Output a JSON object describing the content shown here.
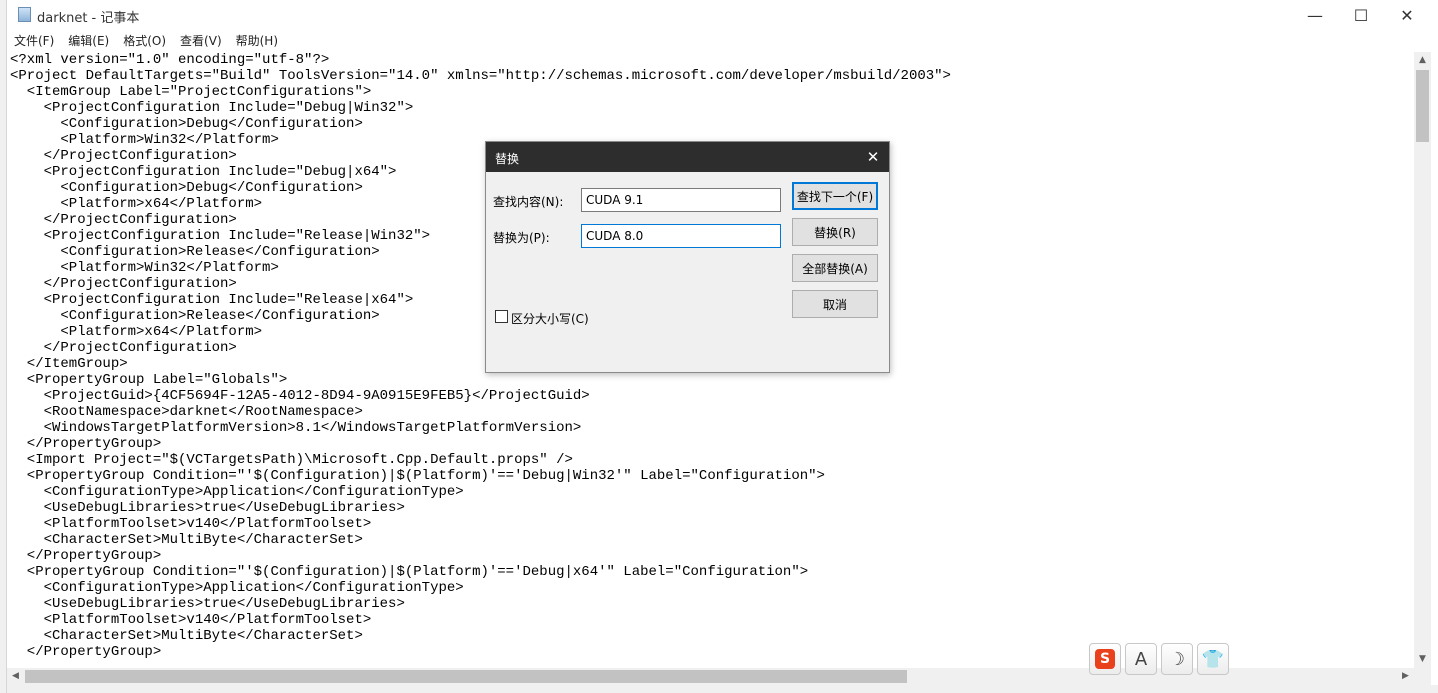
{
  "window": {
    "title": "darknet - 记事本",
    "minimize_glyph": "—",
    "maximize_glyph": "☐",
    "close_glyph": "✕"
  },
  "menu": [
    {
      "label": "文件(F)"
    },
    {
      "label": "编辑(E)"
    },
    {
      "label": "格式(O)"
    },
    {
      "label": "查看(V)"
    },
    {
      "label": "帮助(H)"
    }
  ],
  "editor": {
    "lines": [
      "<?xml version=\"1.0\" encoding=\"utf-8\"?>",
      "<Project DefaultTargets=\"Build\" ToolsVersion=\"14.0\" xmlns=\"http://schemas.microsoft.com/developer/msbuild/2003\">",
      "  <ItemGroup Label=\"ProjectConfigurations\">",
      "    <ProjectConfiguration Include=\"Debug|Win32\">",
      "      <Configuration>Debug</Configuration>",
      "      <Platform>Win32</Platform>",
      "    </ProjectConfiguration>",
      "    <ProjectConfiguration Include=\"Debug|x64\">",
      "      <Configuration>Debug</Configuration>",
      "      <Platform>x64</Platform>",
      "    </ProjectConfiguration>",
      "    <ProjectConfiguration Include=\"Release|Win32\">",
      "      <Configuration>Release</Configuration>",
      "      <Platform>Win32</Platform>",
      "    </ProjectConfiguration>",
      "    <ProjectConfiguration Include=\"Release|x64\">",
      "      <Configuration>Release</Configuration>",
      "      <Platform>x64</Platform>",
      "    </ProjectConfiguration>",
      "  </ItemGroup>",
      "  <PropertyGroup Label=\"Globals\">",
      "    <ProjectGuid>{4CF5694F-12A5-4012-8D94-9A0915E9FEB5}</ProjectGuid>",
      "    <RootNamespace>darknet</RootNamespace>",
      "    <WindowsTargetPlatformVersion>8.1</WindowsTargetPlatformVersion>",
      "  </PropertyGroup>",
      "  <Import Project=\"$(VCTargetsPath)\\Microsoft.Cpp.Default.props\" />",
      "  <PropertyGroup Condition=\"'$(Configuration)|$(Platform)'=='Debug|Win32'\" Label=\"Configuration\">",
      "    <ConfigurationType>Application</ConfigurationType>",
      "    <UseDebugLibraries>true</UseDebugLibraries>",
      "    <PlatformToolset>v140</PlatformToolset>",
      "    <CharacterSet>MultiByte</CharacterSet>",
      "  </PropertyGroup>",
      "  <PropertyGroup Condition=\"'$(Configuration)|$(Platform)'=='Debug|x64'\" Label=\"Configuration\">",
      "    <ConfigurationType>Application</ConfigurationType>",
      "    <UseDebugLibraries>true</UseDebugLibraries>",
      "    <PlatformToolset>v140</PlatformToolset>",
      "    <CharacterSet>MultiByte</CharacterSet>",
      "  </PropertyGroup>"
    ]
  },
  "dialog": {
    "title": "替换",
    "close_glyph": "✕",
    "find_label": "查找内容(N):",
    "find_value": "CUDA 9.1",
    "replace_label": "替换为(P):",
    "replace_value": "CUDA 8.0",
    "find_next_label": "查找下一个(F)",
    "replace_button_label": "替换(R)",
    "replace_all_label": "全部替换(A)",
    "cancel_label": "取消",
    "match_case_label": "区分大小写(C)",
    "match_case_checked": false
  },
  "ime_toolbar": {
    "logo_glyph": "S",
    "font_glyph": "A",
    "moon_glyph": "☽",
    "shirt_glyph": "👕",
    "icons": [
      "sogou-logo-icon",
      "font-icon",
      "moon-icon",
      "shirt-icon"
    ]
  },
  "scrollbars": {
    "up_glyph": "▲",
    "down_glyph": "▼",
    "left_glyph": "◀",
    "right_glyph": "▶"
  },
  "colors": {
    "dialog_titlebar": "#2d2d2d",
    "focus_border": "#0078d7",
    "sogou_brand": "#e8411c"
  }
}
